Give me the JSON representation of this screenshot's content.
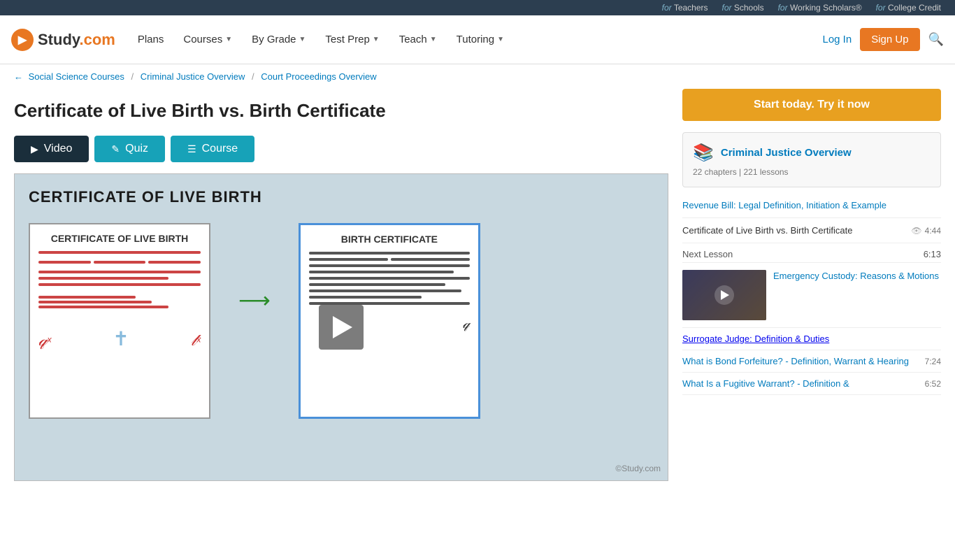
{
  "topbar": {
    "links": [
      {
        "for_label": "for",
        "link_label": "Teachers"
      },
      {
        "for_label": "for",
        "link_label": "Schools"
      },
      {
        "for_label": "for",
        "link_label": "Working Scholars®"
      },
      {
        "for_label": "for",
        "link_label": "College Credit"
      }
    ]
  },
  "nav": {
    "logo_text": "Study.com",
    "links": [
      {
        "label": "Plans",
        "has_dropdown": false
      },
      {
        "label": "Courses",
        "has_dropdown": true
      },
      {
        "label": "By Grade",
        "has_dropdown": true
      },
      {
        "label": "Test Prep",
        "has_dropdown": true
      },
      {
        "label": "Teach",
        "has_dropdown": true
      },
      {
        "label": "Tutoring",
        "has_dropdown": true
      }
    ],
    "login_label": "Log In",
    "signup_label": "Sign Up"
  },
  "breadcrumb": {
    "back_label": "Social Science Courses",
    "middle_label": "Criminal Justice Overview",
    "current_label": "Court Proceedings Overview"
  },
  "page": {
    "title": "Certificate of Live Birth vs. Birth Certificate"
  },
  "tabs": {
    "video_label": "Video",
    "quiz_label": "Quiz",
    "course_label": "Course"
  },
  "video": {
    "title_overlay": "CERTIFICATE OF LIVE BIRTH"
  },
  "sidebar": {
    "cta_label": "Start today. Try it now",
    "course_title": "Criminal Justice Overview",
    "course_meta": "22 chapters | 221 lessons",
    "lessons": [
      {
        "type": "link",
        "label": "Revenue Bill: Legal Definition, Initiation & Example"
      },
      {
        "type": "current",
        "label": "Certificate of Live Birth vs. Birth Certificate",
        "duration": "4:44"
      }
    ],
    "next_lesson": {
      "label": "Next Lesson",
      "duration": "6:13",
      "title": "Emergency Custody: Reasons & Motions"
    },
    "extra_lessons": [
      {
        "label": "Surrogate Judge: Definition & Duties"
      },
      {
        "label": "What is Bond Forfeiture? - Definition, Warrant & Hearing",
        "duration": "7:24"
      },
      {
        "label": "What Is a Fugitive Warrant? - Definition &",
        "duration": "6:52"
      }
    ]
  }
}
